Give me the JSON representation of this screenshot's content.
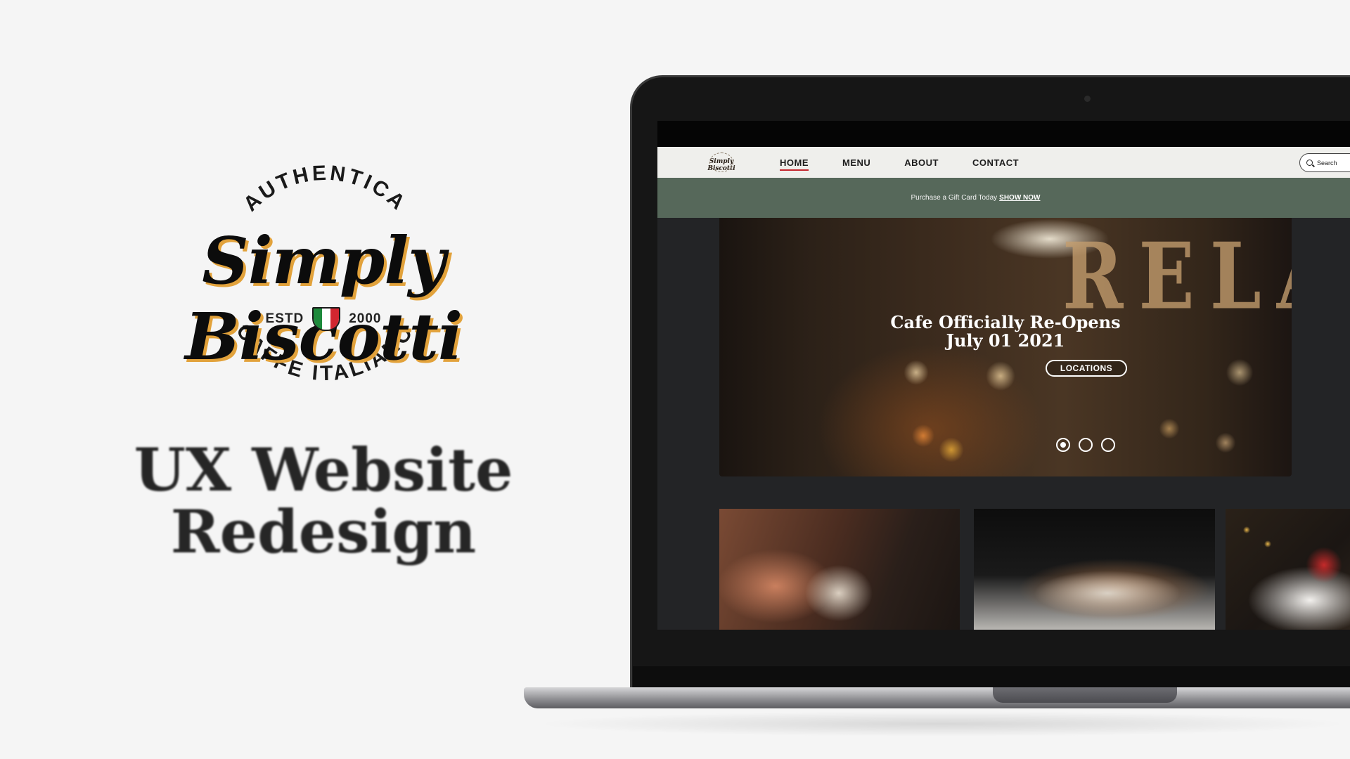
{
  "brand": {
    "arc_top": "AUTHENTICA",
    "name": "Simply Biscotti",
    "estd": "ESTD",
    "year": "2000",
    "arc_bottom": "CAFFE ITALIANO"
  },
  "headline": {
    "line1": "UX Website",
    "line2": "Redesign"
  },
  "site": {
    "logo_text": "Simply Biscotti",
    "nav": {
      "home": "HOME",
      "menu": "MENU",
      "about": "ABOUT",
      "contact": "CONTACT"
    },
    "search": {
      "placeholder": "Search"
    },
    "promo": {
      "text": "Purchase a Gift Card Today",
      "link": "SHOW NOW"
    },
    "hero": {
      "sign": "RELAX",
      "title_line1": "Cafe Officially Re-Opens",
      "title_line2": "July 01 2021",
      "cta": "LOCATIONS",
      "slide_count": 3,
      "active_slide": 1
    }
  },
  "colors": {
    "promo_bg": "#56685a",
    "nav_active_underline": "#c4262d",
    "brand_shadow": "#e2a23b",
    "flag": [
      "#1e8a3c",
      "#ffffff",
      "#d22630"
    ]
  }
}
